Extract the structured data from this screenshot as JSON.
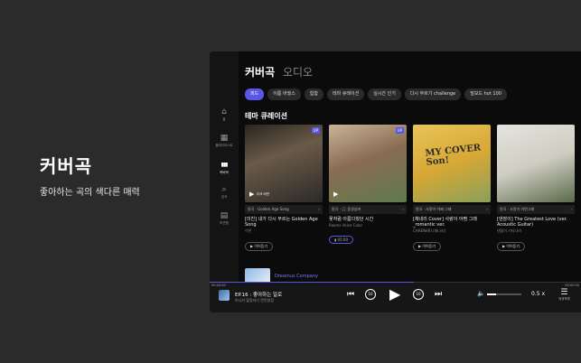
{
  "promo": {
    "title": "커버곡",
    "subtitle": "좋아하는 곡의 색다른 매력"
  },
  "window": {
    "traffic_colors": [
      "#ff5f57",
      "#febc2e",
      "#28c840"
    ]
  },
  "sidebar": {
    "items": [
      {
        "icon": "home-icon",
        "glyph": "⌂",
        "label": "홈"
      },
      {
        "icon": "library-icon",
        "glyph": "▦",
        "label": "플레이리스트"
      },
      {
        "icon": "waveform-icon",
        "glyph": "▮▮▮",
        "label": "커버곡"
      },
      {
        "icon": "search-icon",
        "glyph": "⌕",
        "label": "검색"
      },
      {
        "icon": "radio-icon",
        "glyph": "▤",
        "label": "보관함"
      }
    ]
  },
  "header": {
    "tab_active": "커버곡",
    "tab_inactive": "오디오"
  },
  "chips": [
    "피드",
    "이름 바꿨스",
    "힙합",
    "테마 큐레이션",
    "실시간 인기",
    "다시 부르기 challenge",
    "빌보드 hot 100"
  ],
  "section_title": "테마 큐레이션",
  "cards": [
    {
      "badge": "UP",
      "overlay": "다크 버젼",
      "meta_left": "원곡 · Golden Age Song",
      "title": "[미친] 내가 다시 부르는 Golden Age Song",
      "artist": "이찬",
      "pill": "▶ 이어듣기",
      "bg": "linear-gradient(160deg,#2a2520 0%,#6a5a48 40%,#2c2a28 100%)"
    },
    {
      "badge": "UP",
      "overlay": "",
      "meta_left": "원곡 · 🎧 동영상버",
      "title": "꽃처럼 아름다웠던 시간",
      "artist": "Rooms Voice Color",
      "pill": "▮ 05:00",
      "bg": "linear-gradient(160deg,#c8b49a 0%,#8a6c52 45%,#5e7a4e 100%)"
    },
    {
      "badge": "",
      "overlay": "",
      "meta_left": "원곡 · 사랑이 어쩌 그래",
      "title": "[채내리 Cover] 사랑이 어쩜 그래 _romantic ver.",
      "artist": "CHAENARI (채나리)",
      "pill": "▶ 이어듣기",
      "cover_text": "MY COVER Son!",
      "bg": "linear-gradient(160deg,#e8c45a 0%,#d7a834 50%,#8aa05a 100%)"
    },
    {
      "badge": "",
      "overlay": "",
      "meta_left": "원곡 · 사랑이 어쩐그래",
      "title": "[댄잠이] The Greatest Love (ver. Acoustic Guitar)",
      "artist": "댄잠이 기타나라",
      "pill": "▶ 이어듣기",
      "bg": "linear-gradient(160deg,#e4e4de 0%,#cfcdc2 50%,#5b6a4a 100%)"
    }
  ],
  "lower": {
    "label": "Dreamus Company"
  },
  "player": {
    "time_elapsed": "00:00:00",
    "time_total": "00:00:00",
    "progress": 0.55,
    "title": "EP.16 : 좋아하는 일로",
    "subtitle": "아니카 힐링라디 문탄방장",
    "rewind_label": "10",
    "forward_label": "10",
    "volume": 0.25,
    "speed": "0.5 x",
    "playlist_label": "재생목록"
  }
}
